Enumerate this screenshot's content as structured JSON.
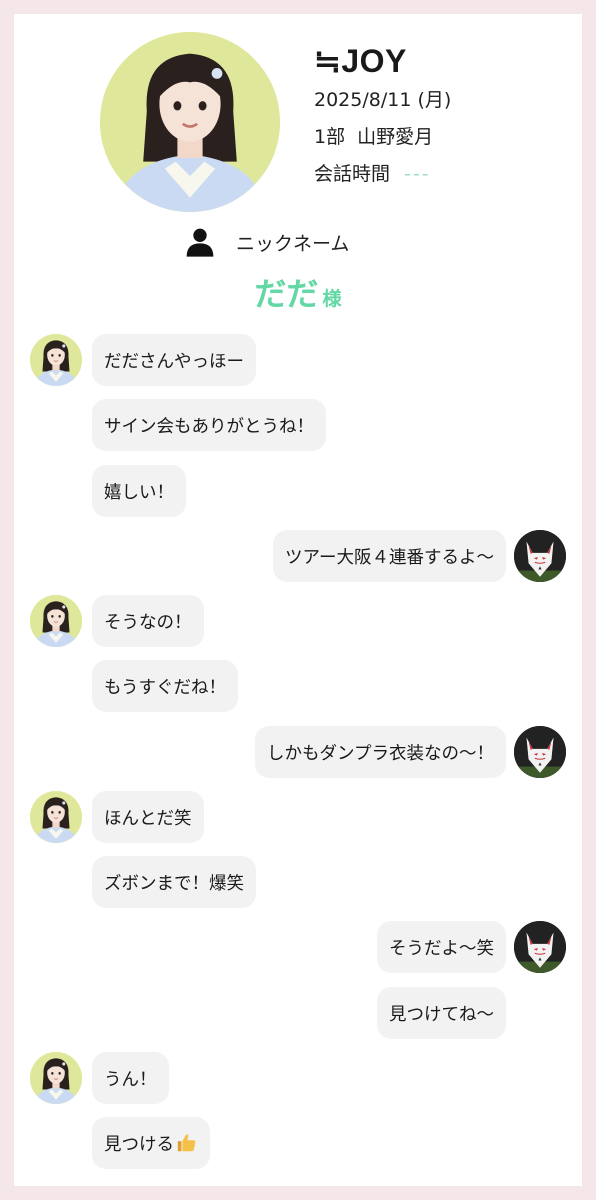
{
  "profile": {
    "group": "≒JOY",
    "date": "2025/8/11 (月)",
    "session": "1部  山野愛月",
    "talk_time_label": "会話時間",
    "talk_time_value": "---"
  },
  "nickname": {
    "label": "ニックネーム",
    "value": "だだ",
    "suffix": "様"
  },
  "messages": [
    {
      "from": "idol",
      "text": "だださんやっほー"
    },
    {
      "from": "idol",
      "text": "サイン会もありがとうね！"
    },
    {
      "from": "idol",
      "text": "嬉しい！"
    },
    {
      "from": "user",
      "text": "ツアー大阪４連番するよ〜"
    },
    {
      "from": "idol",
      "text": "そうなの！"
    },
    {
      "from": "idol",
      "text": "もうすぐだね！"
    },
    {
      "from": "user",
      "text": "しかもダンプラ衣装なの〜！"
    },
    {
      "from": "idol",
      "text": "ほんとだ笑"
    },
    {
      "from": "idol",
      "text": "ズボンまで！爆笑"
    },
    {
      "from": "user",
      "text": "そうだよ〜笑"
    },
    {
      "from": "user",
      "text": "見つけてね〜"
    },
    {
      "from": "idol",
      "text": "うん！"
    },
    {
      "from": "idol",
      "text": "見つける",
      "emoji": "thumbs-up-icon"
    }
  ],
  "colors": {
    "page_border": "#f5e6ea",
    "accent": "#63d8a5",
    "bubble": "#f2f2f2",
    "idol_avatar_bg": "#dfe89a"
  }
}
